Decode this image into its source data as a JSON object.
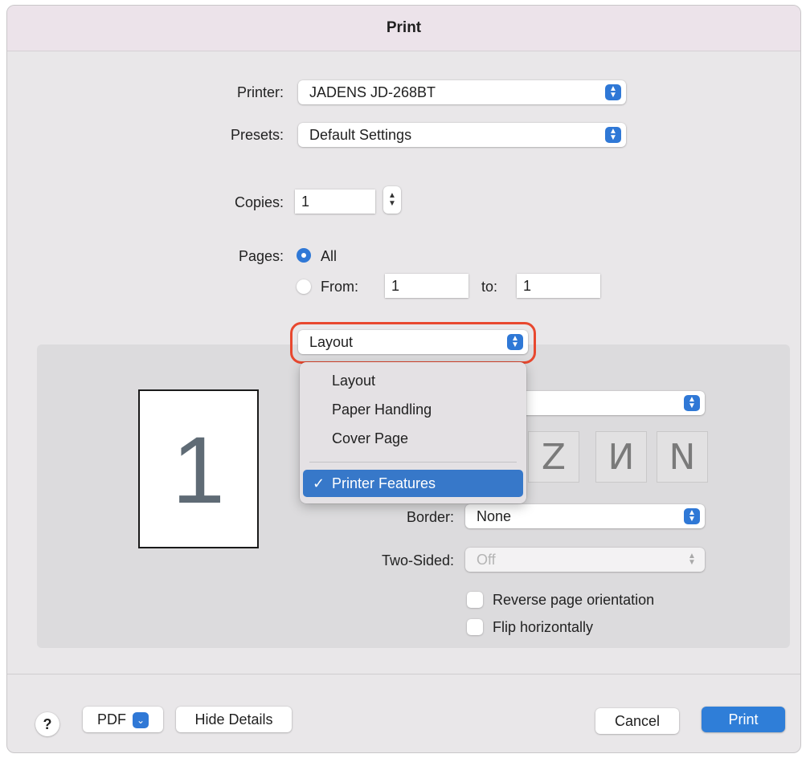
{
  "dialog": {
    "title": "Print"
  },
  "printer": {
    "label": "Printer:",
    "value": "JADENS JD-268BT"
  },
  "presets": {
    "label": "Presets:",
    "value": "Default Settings"
  },
  "copies": {
    "label": "Copies:",
    "value": "1"
  },
  "pages": {
    "label": "Pages:",
    "all_label": "All",
    "from_label": "From:",
    "from_value": "1",
    "to_label": "to:",
    "to_value": "1",
    "selected": "All"
  },
  "section_popup": {
    "value": "Layout"
  },
  "section_menu": {
    "items": [
      "Layout",
      "Paper Handling",
      "Cover Page",
      "Printer Features"
    ],
    "checked": "Printer Features",
    "check_glyph": "✓"
  },
  "preview": {
    "page_number": "1"
  },
  "layout_direction_icons": [
    "Z",
    "И",
    "N"
  ],
  "border": {
    "label": "Border:",
    "value": "None"
  },
  "two_sided": {
    "label": "Two-Sided:",
    "value": "Off",
    "enabled": false
  },
  "options": {
    "reverse_label": "Reverse page orientation",
    "flip_label": "Flip horizontally"
  },
  "footer": {
    "help_label": "?",
    "pdf_label": "PDF",
    "hide_details_label": "Hide Details",
    "cancel_label": "Cancel",
    "print_label": "Print"
  },
  "colors": {
    "accent": "#2f78d6",
    "highlight_ring": "#e8482f",
    "menu_selected": "#3778c9"
  }
}
